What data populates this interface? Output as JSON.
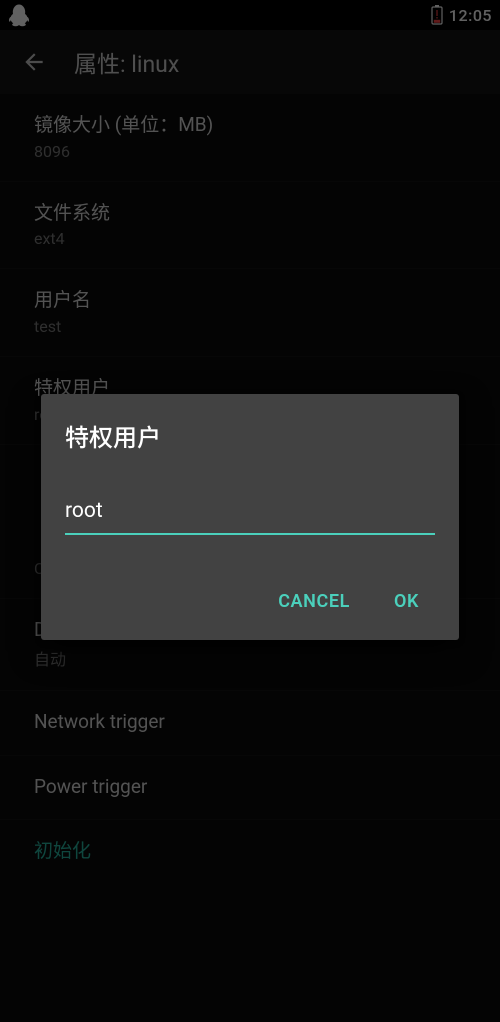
{
  "status": {
    "clock": "12:05"
  },
  "appbar": {
    "title": "属性: linux"
  },
  "settings": {
    "image_size": {
      "title": "镜像大小 (单位：MB)",
      "value": "8096"
    },
    "filesystem": {
      "title": "文件系统",
      "value": "ext4"
    },
    "username": {
      "title": "用户名",
      "value": "test"
    },
    "priv_user": {
      "title": "特权用户",
      "value": "root"
    },
    "locale": {
      "title": "",
      "value": "C"
    },
    "dns": {
      "title": "DNS",
      "value": "自动"
    },
    "net_trigger": {
      "title": "Network trigger"
    },
    "pwr_trigger": {
      "title": "Power trigger"
    },
    "init": {
      "title": "初始化"
    }
  },
  "dialog": {
    "title": "特权用户",
    "value": "root",
    "cancel": "CANCEL",
    "ok": "OK"
  },
  "colors": {
    "accent": "#4bd0bc",
    "dialog_bg": "#424242"
  }
}
